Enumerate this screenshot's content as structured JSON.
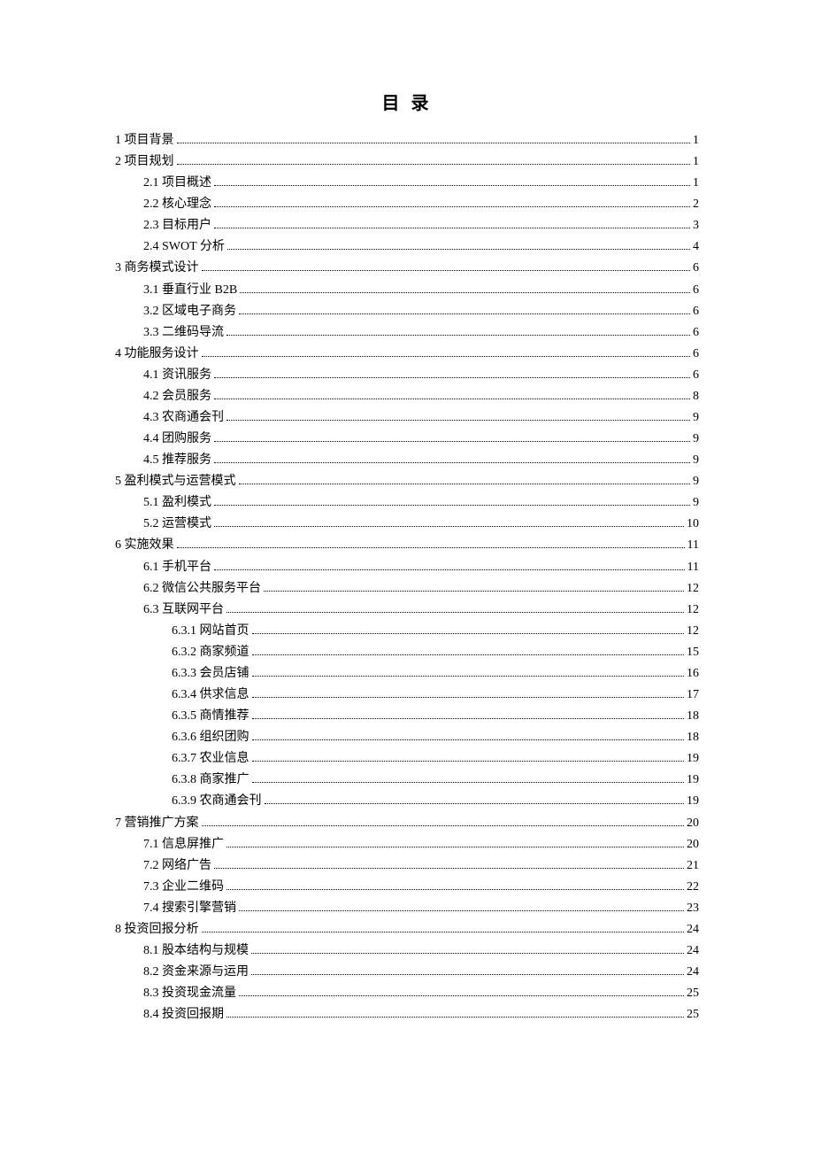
{
  "title": "目 录",
  "entries": [
    {
      "level": 1,
      "label": "1 项目背景",
      "page": "1"
    },
    {
      "level": 1,
      "label": "2 项目规划",
      "page": "1"
    },
    {
      "level": 2,
      "label": "2.1 项目概述",
      "page": "1"
    },
    {
      "level": 2,
      "label": "2.2 核心理念",
      "page": "2"
    },
    {
      "level": 2,
      "label": "2.3 目标用户",
      "page": "3"
    },
    {
      "level": 2,
      "label": "2.4 SWOT 分析",
      "page": "4"
    },
    {
      "level": 1,
      "label": "3 商务模式设计",
      "page": "6"
    },
    {
      "level": 2,
      "label": "3.1 垂直行业 B2B",
      "page": "6"
    },
    {
      "level": 2,
      "label": "3.2 区域电子商务",
      "page": "6"
    },
    {
      "level": 2,
      "label": "3.3 二维码导流",
      "page": "6"
    },
    {
      "level": 1,
      "label": "4 功能服务设计",
      "page": "6"
    },
    {
      "level": 2,
      "label": "4.1 资讯服务",
      "page": "6"
    },
    {
      "level": 2,
      "label": "4.2 会员服务",
      "page": "8"
    },
    {
      "level": 2,
      "label": "4.3 农商通会刊",
      "page": "9"
    },
    {
      "level": 2,
      "label": "4.4 团购服务",
      "page": "9"
    },
    {
      "level": 2,
      "label": "4.5 推荐服务",
      "page": "9"
    },
    {
      "level": 1,
      "label": "5 盈利模式与运营模式",
      "page": "9"
    },
    {
      "level": 2,
      "label": "5.1 盈利模式",
      "page": "9"
    },
    {
      "level": 2,
      "label": "5.2 运营模式",
      "page": "10"
    },
    {
      "level": 1,
      "label": "6 实施效果",
      "page": "11"
    },
    {
      "level": 2,
      "label": "6.1 手机平台",
      "page": "11"
    },
    {
      "level": 2,
      "label": "6.2 微信公共服务平台",
      "page": "12"
    },
    {
      "level": 2,
      "label": "6.3 互联网平台",
      "page": "12"
    },
    {
      "level": 3,
      "label": "6.3.1 网站首页",
      "page": "12"
    },
    {
      "level": 3,
      "label": "6.3.2 商家频道",
      "page": "15"
    },
    {
      "level": 3,
      "label": "6.3.3 会员店铺",
      "page": "16"
    },
    {
      "level": 3,
      "label": "6.3.4 供求信息",
      "page": "17"
    },
    {
      "level": 3,
      "label": "6.3.5 商情推荐",
      "page": "18"
    },
    {
      "level": 3,
      "label": "6.3.6 组织团购",
      "page": "18"
    },
    {
      "level": 3,
      "label": "6.3.7 农业信息",
      "page": "19"
    },
    {
      "level": 3,
      "label": "6.3.8 商家推广",
      "page": "19"
    },
    {
      "level": 3,
      "label": "6.3.9 农商通会刊",
      "page": "19"
    },
    {
      "level": 1,
      "label": "7 营销推广方案",
      "page": "20"
    },
    {
      "level": 2,
      "label": "7.1 信息屏推广",
      "page": "20"
    },
    {
      "level": 2,
      "label": "7.2 网络广告",
      "page": "21"
    },
    {
      "level": 2,
      "label": "7.3 企业二维码",
      "page": "22"
    },
    {
      "level": 2,
      "label": "7.4 搜索引擎营销",
      "page": "23"
    },
    {
      "level": 1,
      "label": "8 投资回报分析",
      "page": "24"
    },
    {
      "level": 2,
      "label": "8.1 股本结构与规模",
      "page": "24"
    },
    {
      "level": 2,
      "label": "8.2 资金来源与运用",
      "page": "24"
    },
    {
      "level": 2,
      "label": "8.3 投资现金流量",
      "page": "25"
    },
    {
      "level": 2,
      "label": "8.4 投资回报期",
      "page": "25"
    }
  ]
}
